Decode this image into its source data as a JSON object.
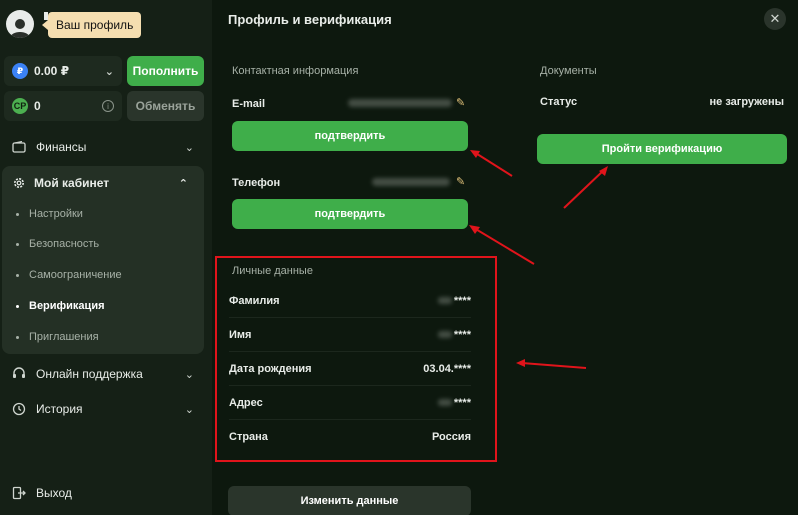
{
  "header": {
    "tooltip": "Ваш профиль"
  },
  "wallet": {
    "balance": "0.00 ₽",
    "currency_icon": "ruble-coin-icon",
    "topup_label": "Пополнить",
    "cp_balance": "0",
    "cp_icon_text": "CP",
    "exchange_label": "Обменять"
  },
  "sidebar": {
    "finance": "Финансы",
    "cabinet": "Мой кабинет",
    "cabinet_items": [
      {
        "label": "Настройки",
        "active": false
      },
      {
        "label": "Безопасность",
        "active": false
      },
      {
        "label": "Самоограничение",
        "active": false
      },
      {
        "label": "Верификация",
        "active": true
      },
      {
        "label": "Приглашения",
        "active": false
      }
    ],
    "support": "Онлайн поддержка",
    "history": "История",
    "logout": "Выход"
  },
  "modal": {
    "title": "Профиль и верификация",
    "contacts": {
      "section": "Контактная информация",
      "email_label": "E-mail",
      "email_confirm": "подтвердить",
      "phone_label": "Телефон",
      "phone_confirm": "подтвердить"
    },
    "personal": {
      "section": "Личные данные",
      "rows": [
        {
          "label": "Фамилия",
          "value": "****"
        },
        {
          "label": "Имя",
          "value": "****"
        },
        {
          "label": "Дата рождения",
          "value": "03.04.****"
        },
        {
          "label": "Адрес",
          "value": "****"
        },
        {
          "label": "Страна",
          "value": "Россия"
        }
      ]
    },
    "change_button": "Изменить данные",
    "documents": {
      "section": "Документы",
      "status_label": "Статус",
      "status_value": "не загружены",
      "verify_button": "Пройти верификацию"
    }
  },
  "colors": {
    "accent_green": "#3fae4a",
    "highlight_red": "#e0141b"
  }
}
